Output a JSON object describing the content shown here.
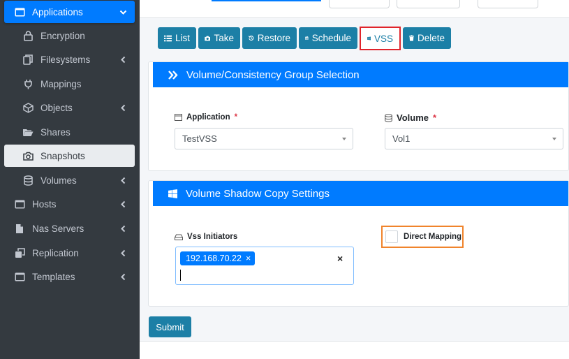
{
  "sidebar": {
    "items": [
      {
        "label": "Applications",
        "icon": "window-icon"
      },
      {
        "label": "Encryption",
        "icon": "lock-icon"
      },
      {
        "label": "Filesystems",
        "icon": "copy-icon"
      },
      {
        "label": "Mappings",
        "icon": "plug-icon"
      },
      {
        "label": "Objects",
        "icon": "cube-icon"
      },
      {
        "label": "Shares",
        "icon": "folder-open-icon"
      },
      {
        "label": "Snapshots",
        "icon": "camera-icon"
      },
      {
        "label": "Volumes",
        "icon": "database-icon"
      },
      {
        "label": "Hosts",
        "icon": "server-icon"
      },
      {
        "label": "Nas Servers",
        "icon": "file-icon"
      },
      {
        "label": "Replication",
        "icon": "clone-icon"
      },
      {
        "label": "Templates",
        "icon": "window-icon"
      }
    ]
  },
  "tabs": {
    "list": "List",
    "take": "Take",
    "restore": "Restore",
    "schedule": "Schedule",
    "vss": "VSS",
    "delete": "Delete"
  },
  "selection_card": {
    "title": "Volume/Consistency Group Selection",
    "application_label": "Application",
    "application_value": "TestVSS",
    "volume_label": "Volume",
    "volume_value": "Vol1",
    "required_mark": "*"
  },
  "vss_card": {
    "title": "Volume Shadow Copy Settings",
    "initiators_label": "Vss Initiators",
    "initiator_chip": "192.168.70.22",
    "chip_remove": "×",
    "clear_all": "×",
    "direct_mapping_label": "Direct Mapping"
  },
  "submit_label": "Submit",
  "colors": {
    "primary": "#007bff",
    "button": "#1c7fa6",
    "sidebar": "#343a40",
    "highlight_red": "#e0242b",
    "highlight_orange": "#f0842c"
  }
}
